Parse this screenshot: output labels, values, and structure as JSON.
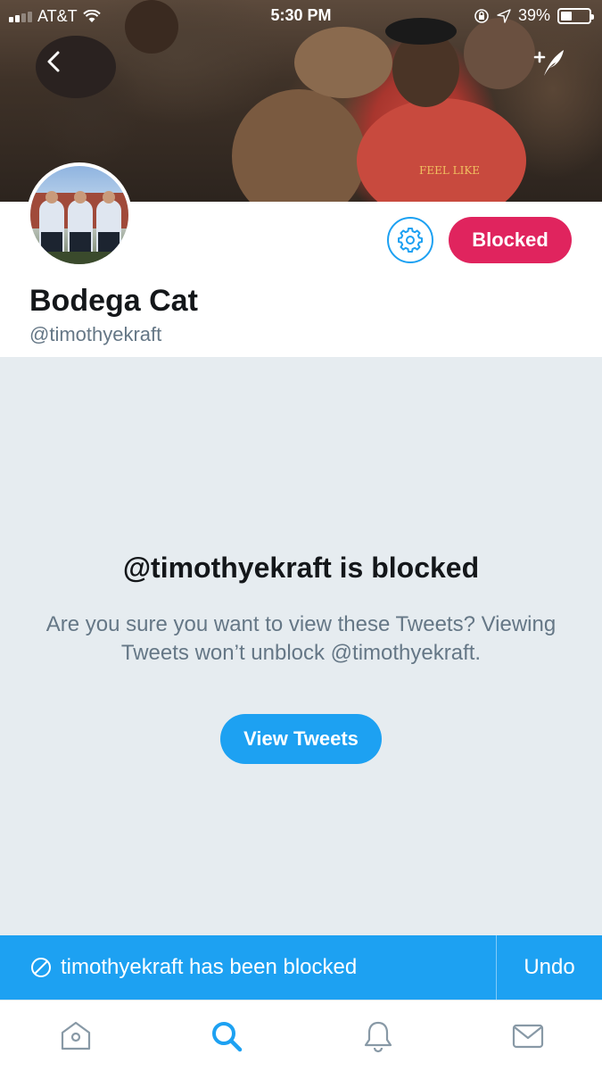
{
  "status_bar": {
    "carrier": "AT&T",
    "time": "5:30 PM",
    "battery": "39%"
  },
  "header": {
    "banner_shirt_text": "FEEL LIKE",
    "back_icon": "chevron-left-icon",
    "compose_icon": "compose-tweet-icon"
  },
  "profile": {
    "name": "Bodega Cat",
    "handle": "@timothyekraft",
    "settings_icon": "gear-icon",
    "blocked_label": "Blocked"
  },
  "blocked_notice": {
    "title": "@timothyekraft is blocked",
    "description": "Are you sure you want to view these Tweets? Viewing Tweets won’t unblock @timothyekraft.",
    "button_label": "View Tweets"
  },
  "toast": {
    "icon": "blocked-circle-icon",
    "message": "timothyekraft has been blocked",
    "undo_label": "Undo"
  },
  "tab_bar": {
    "tabs": [
      {
        "icon": "home-icon",
        "active": false
      },
      {
        "icon": "search-icon",
        "active": true
      },
      {
        "icon": "notifications-bell-icon",
        "active": false
      },
      {
        "icon": "messages-envelope-icon",
        "active": false
      }
    ]
  },
  "colors": {
    "twitter_blue": "#1da1f2",
    "blocked_red": "#e0245e",
    "text_primary": "#14171a",
    "text_secondary": "#657786",
    "blocked_background": "#e6ecf0",
    "tab_inactive": "#8899a6"
  }
}
